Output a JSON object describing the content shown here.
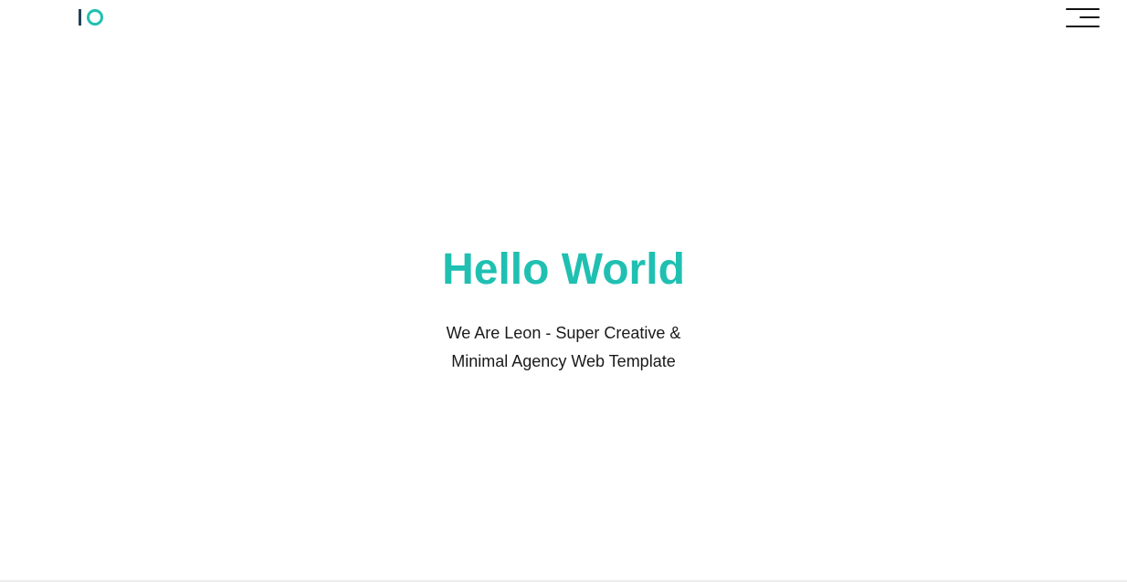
{
  "brand": {
    "logo_icon": "io-logo-icon",
    "accent_color": "#1fc0b1",
    "dark_color": "#22435a"
  },
  "header": {
    "menu_icon": "hamburger-menu-icon"
  },
  "hero": {
    "title": "Hello World",
    "subtitle": "We Are Leon - Super Creative & Minimal Agency Web Template"
  }
}
